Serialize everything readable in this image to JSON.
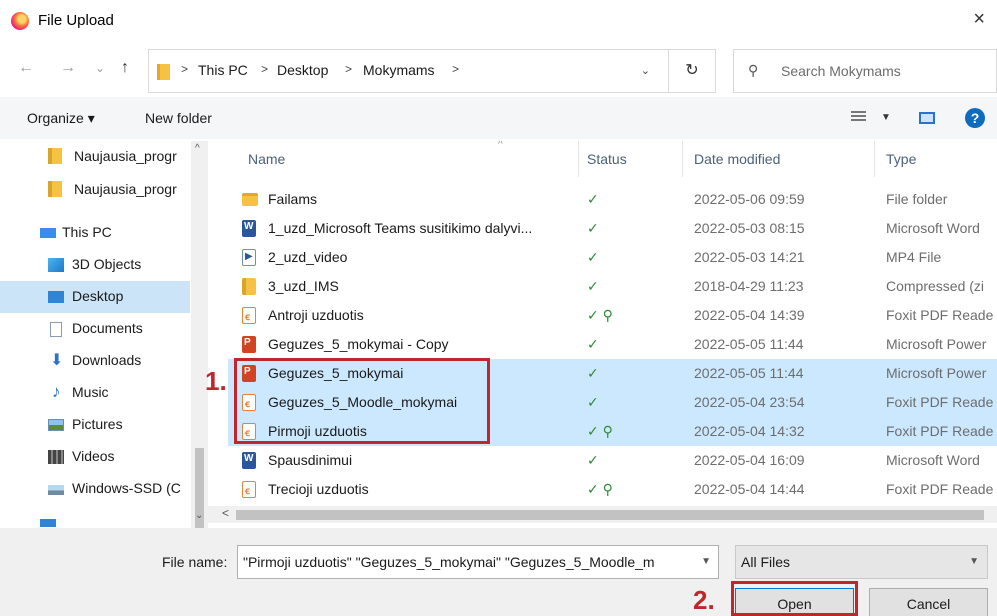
{
  "window": {
    "title": "File Upload",
    "close_glyph": "×"
  },
  "nav": {
    "back_glyph": "←",
    "forward_glyph": "→",
    "recent_glyph": "⌄",
    "up_glyph": "↑",
    "breadcrumbs": [
      "This PC",
      "Desktop",
      "Mokymams"
    ],
    "sep_glyph": ">",
    "address_dropdown_glyph": "⌄",
    "refresh_glyph": "↻",
    "search_placeholder": "Search Mokymams"
  },
  "toolbar": {
    "organize_label": "Organize ▾",
    "new_folder_label": "New folder",
    "help_glyph": "?"
  },
  "sidebar": {
    "items": [
      {
        "label": "Naujausia_progr",
        "icon": "zip-folder-icon"
      },
      {
        "label": "Naujausia_progr",
        "icon": "zip-folder-icon"
      },
      {
        "label": "This PC",
        "icon": "computer-icon"
      },
      {
        "label": "3D Objects",
        "icon": "3d-objects-icon"
      },
      {
        "label": "Desktop",
        "icon": "desktop-icon",
        "selected": true
      },
      {
        "label": "Documents",
        "icon": "documents-icon"
      },
      {
        "label": "Downloads",
        "icon": "downloads-icon"
      },
      {
        "label": "Music",
        "icon": "music-icon"
      },
      {
        "label": "Pictures",
        "icon": "pictures-icon"
      },
      {
        "label": "Videos",
        "icon": "videos-icon"
      },
      {
        "label": "Windows-SSD (C",
        "icon": "drive-icon"
      }
    ]
  },
  "columns": {
    "name": "Name",
    "status": "Status",
    "date": "Date modified",
    "type": "Type"
  },
  "files": [
    {
      "name": "Failams",
      "status": "✓",
      "date": "2022-05-06 09:59",
      "type": "File folder",
      "icon": "folder",
      "selected": false
    },
    {
      "name": "1_uzd_Microsoft Teams susitikimo dalyvi...",
      "status": "✓",
      "date": "2022-05-03 08:15",
      "type": "Microsoft Word",
      "icon": "word",
      "selected": false
    },
    {
      "name": "2_uzd_video",
      "status": "✓",
      "date": "2022-05-03 14:21",
      "type": "MP4 File",
      "icon": "mp4",
      "selected": false
    },
    {
      "name": "3_uzd_IMS",
      "status": "✓",
      "date": "2018-04-29 11:23",
      "type": "Compressed (zi",
      "icon": "zip",
      "selected": false
    },
    {
      "name": "Antroji uzduotis",
      "status": "✓ ⚲",
      "date": "2022-05-04 14:39",
      "type": "Foxit PDF Reade",
      "icon": "pdf",
      "selected": false
    },
    {
      "name": "Geguzes_5_mokymai - Copy",
      "status": "✓",
      "date": "2022-05-05 11:44",
      "type": "Microsoft Power",
      "icon": "ppt",
      "selected": false
    },
    {
      "name": "Geguzes_5_mokymai",
      "status": "✓",
      "date": "2022-05-05 11:44",
      "type": "Microsoft Power",
      "icon": "ppt",
      "selected": true
    },
    {
      "name": "Geguzes_5_Moodle_mokymai",
      "status": "✓",
      "date": "2022-05-04 23:54",
      "type": "Foxit PDF Reade",
      "icon": "pdf",
      "selected": true
    },
    {
      "name": "Pirmoji uzduotis",
      "status": "✓ ⚲",
      "date": "2022-05-04 14:32",
      "type": "Foxit PDF Reade",
      "icon": "pdf",
      "selected": true
    },
    {
      "name": "Spausdinimui",
      "status": "✓",
      "date": "2022-05-04 16:09",
      "type": "Microsoft Word",
      "icon": "word",
      "selected": false
    },
    {
      "name": "Trecioji uzduotis",
      "status": "✓ ⚲",
      "date": "2022-05-04 14:44",
      "type": "Foxit PDF Reade",
      "icon": "pdf",
      "selected": false
    }
  ],
  "bottom": {
    "filename_label": "File name:",
    "filename_value": "\"Pirmoji uzduotis\" \"Geguzes_5_mokymai\" \"Geguzes_5_Moodle_m",
    "filter_value": "All Files",
    "open_label": "Open",
    "cancel_label": "Cancel"
  },
  "annotations": {
    "step1": "1.",
    "step2": "2."
  },
  "colors": {
    "accent": "#0078d7",
    "selection": "#cce8ff",
    "annotation": "#c0272d"
  }
}
